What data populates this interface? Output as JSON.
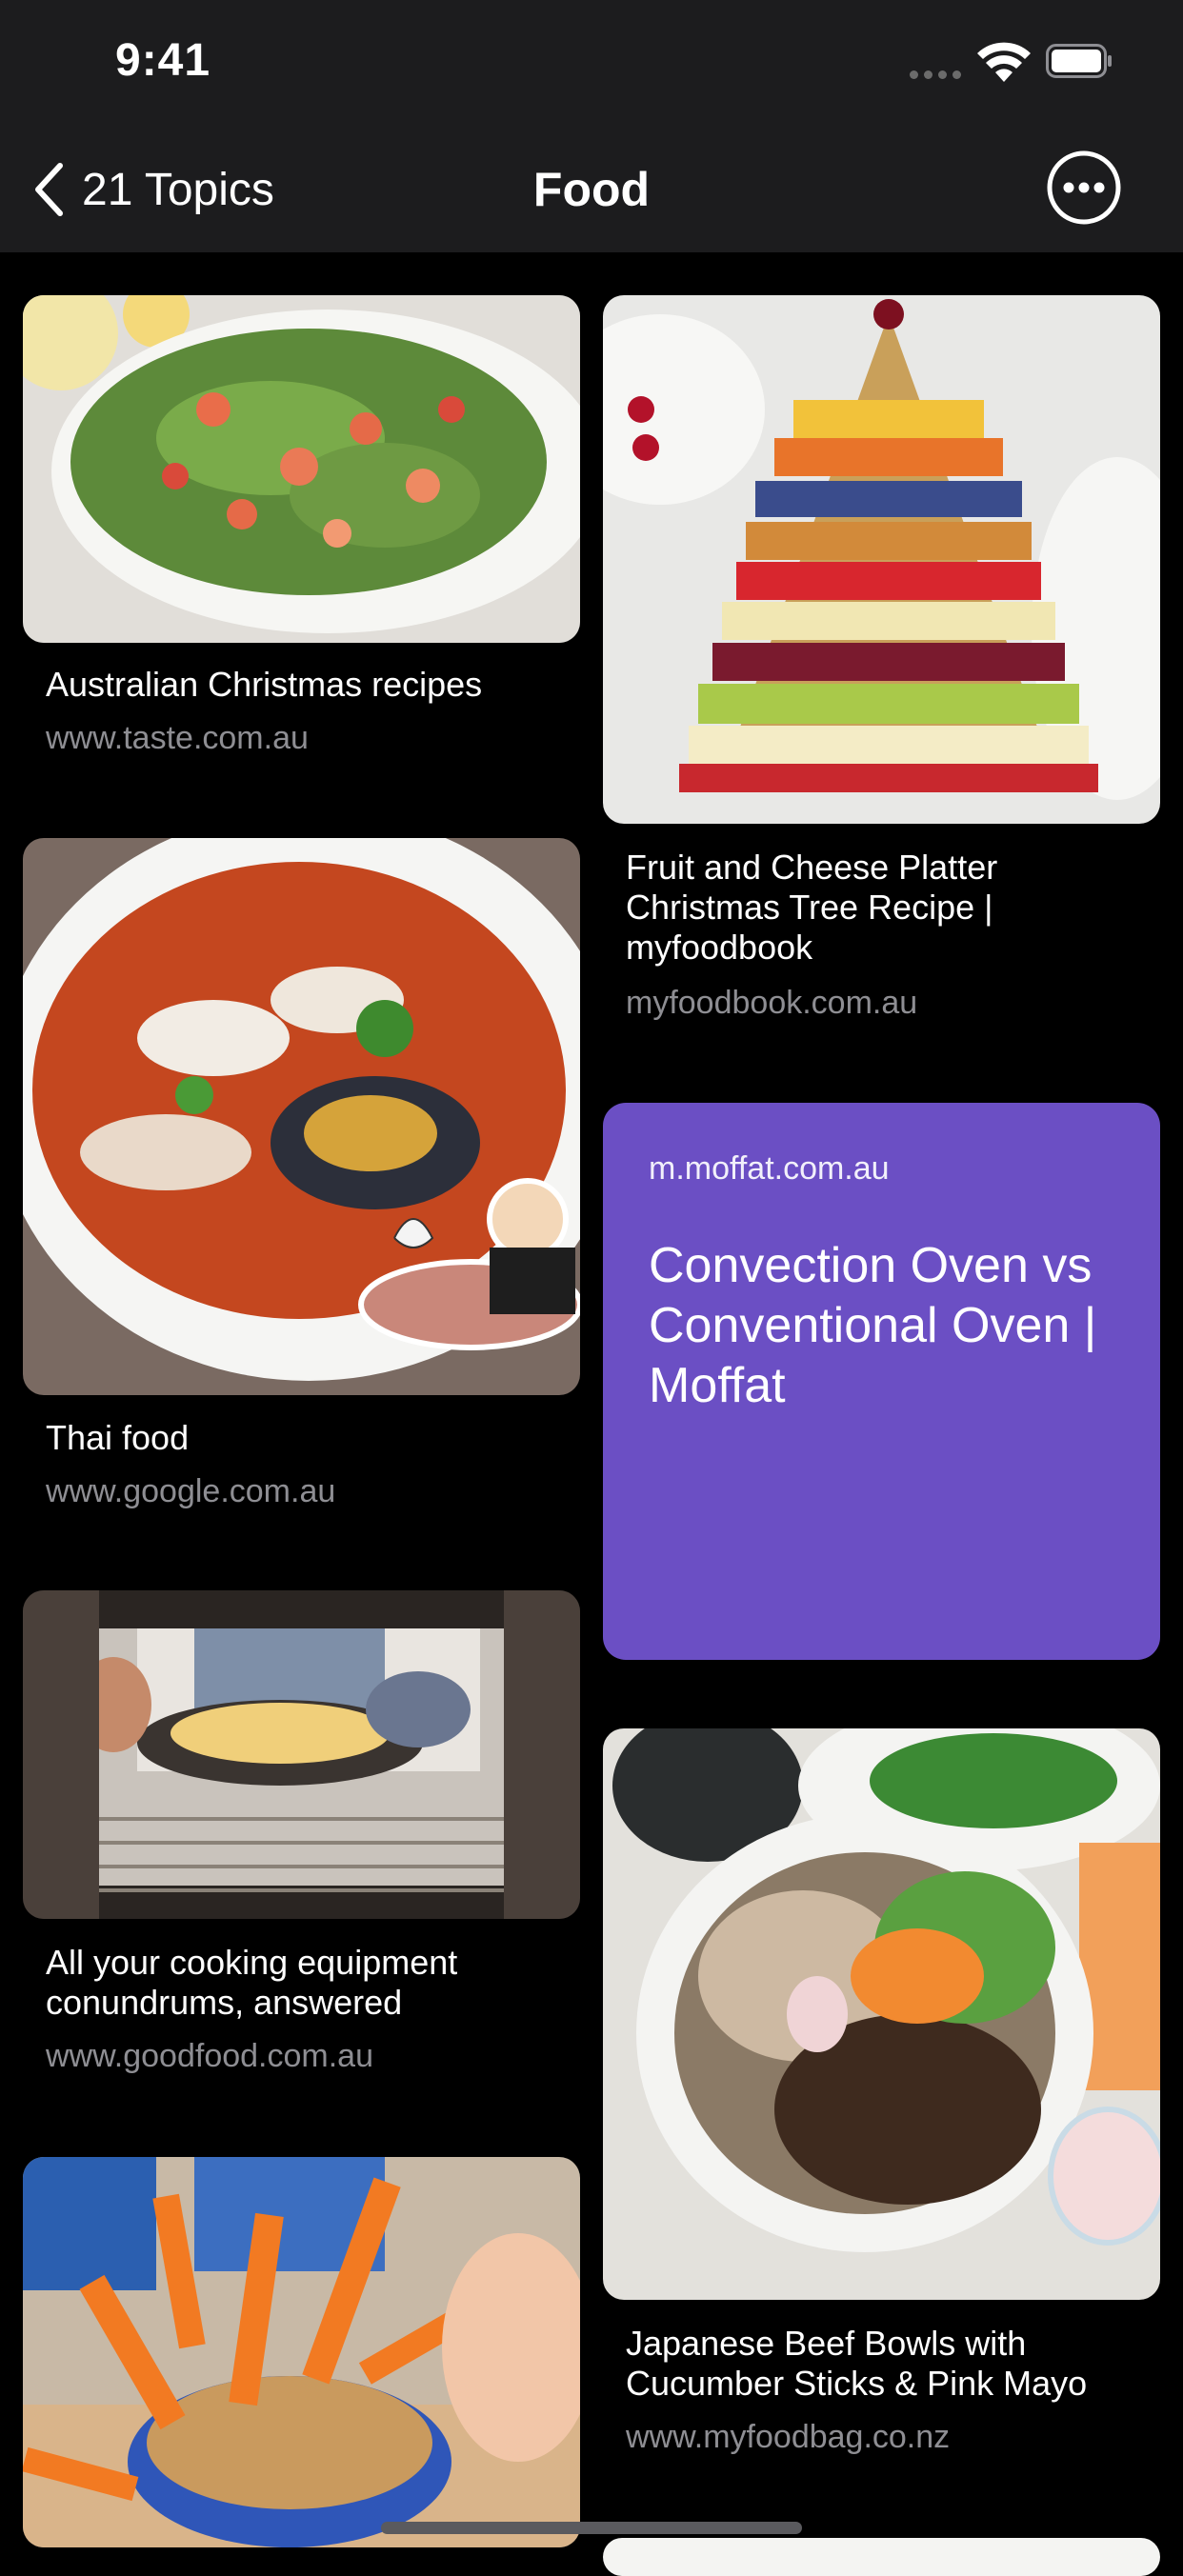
{
  "status_bar": {
    "time": "9:41",
    "icons": [
      "cellular-signal-icon",
      "wifi-icon",
      "battery-icon"
    ]
  },
  "nav": {
    "back_label": "21 Topics",
    "title": "Food",
    "icons": [
      "chevron-left-icon",
      "more-options-icon"
    ]
  },
  "colors": {
    "background": "#000000",
    "bar": "#1c1c1e",
    "text_card": "#6b4fc4",
    "secondary_text": "#8e8e93"
  },
  "cards": [
    {
      "title": "Australian Christmas recipes",
      "url": "www.taste.com.au",
      "image": "salad-with-prawns-photo"
    },
    {
      "title": "Fruit and Cheese Platter Christmas Tree Recipe | myfoodbook",
      "url": "myfoodbook.com.au",
      "image": "fruit-cheese-tree-photo"
    },
    {
      "title": "Thai food",
      "url": "www.google.com.au",
      "image": "seafood-soup-photo"
    },
    {
      "source": "m.moffat.com.au",
      "headline": "Convection Oven vs Conventional Oven | Moffat"
    },
    {
      "title": "All your cooking equipment conundrums, answered",
      "url": "www.goodfood.com.au",
      "image": "oven-baking-photo"
    },
    {
      "title": "Japanese Beef Bowls with Cucumber Sticks & Pink Mayo",
      "url": "www.myfoodbag.co.nz",
      "image": "beef-bowl-photo"
    },
    {
      "image": "carrots-peanut-butter-photo"
    }
  ]
}
